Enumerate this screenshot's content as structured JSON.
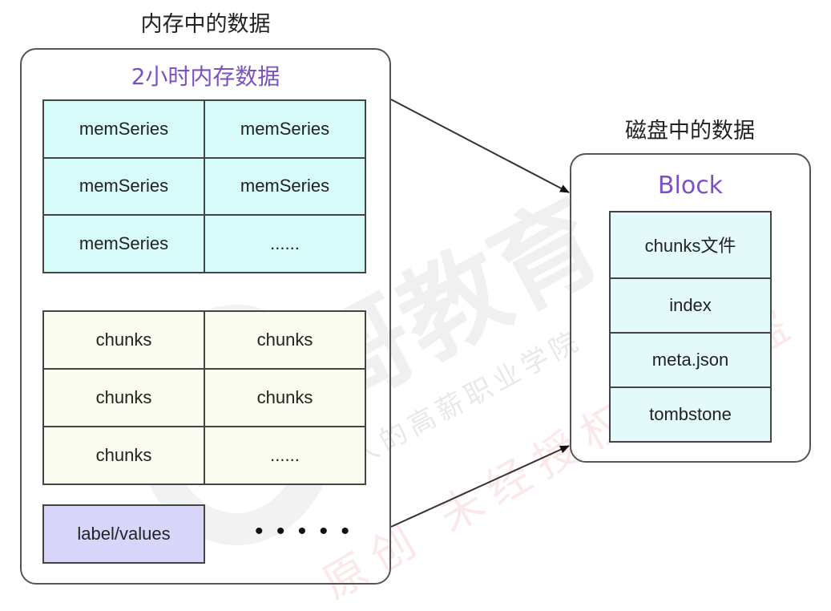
{
  "memory": {
    "title": "内存中的数据",
    "subtitle": "2小时内存数据",
    "series_table": [
      [
        "memSeries",
        "memSeries"
      ],
      [
        "memSeries",
        "memSeries"
      ],
      [
        "memSeries",
        "......"
      ]
    ],
    "chunks_table": [
      [
        "chunks",
        "chunks"
      ],
      [
        "chunks",
        "chunks"
      ],
      [
        "chunks",
        "......"
      ]
    ],
    "label_box": "label/values",
    "more": "• • • • •"
  },
  "disk": {
    "title": "磁盘中的数据",
    "block_title": "Block",
    "block_items": [
      "chunks文件",
      "index",
      "meta.json",
      "tombstone"
    ]
  },
  "colors": {
    "accent_purple": "#7a52c2",
    "series_cell": "#d6fbf8",
    "chunks_cell": "#f9fcef",
    "block_cell": "#e4fafa",
    "label_cell": "#d8d5fb"
  },
  "watermark": {
    "brand": "马哥教育",
    "slogan": "IT人的高薪职业学院",
    "notice": "原创 未经授权 禁止盗"
  }
}
